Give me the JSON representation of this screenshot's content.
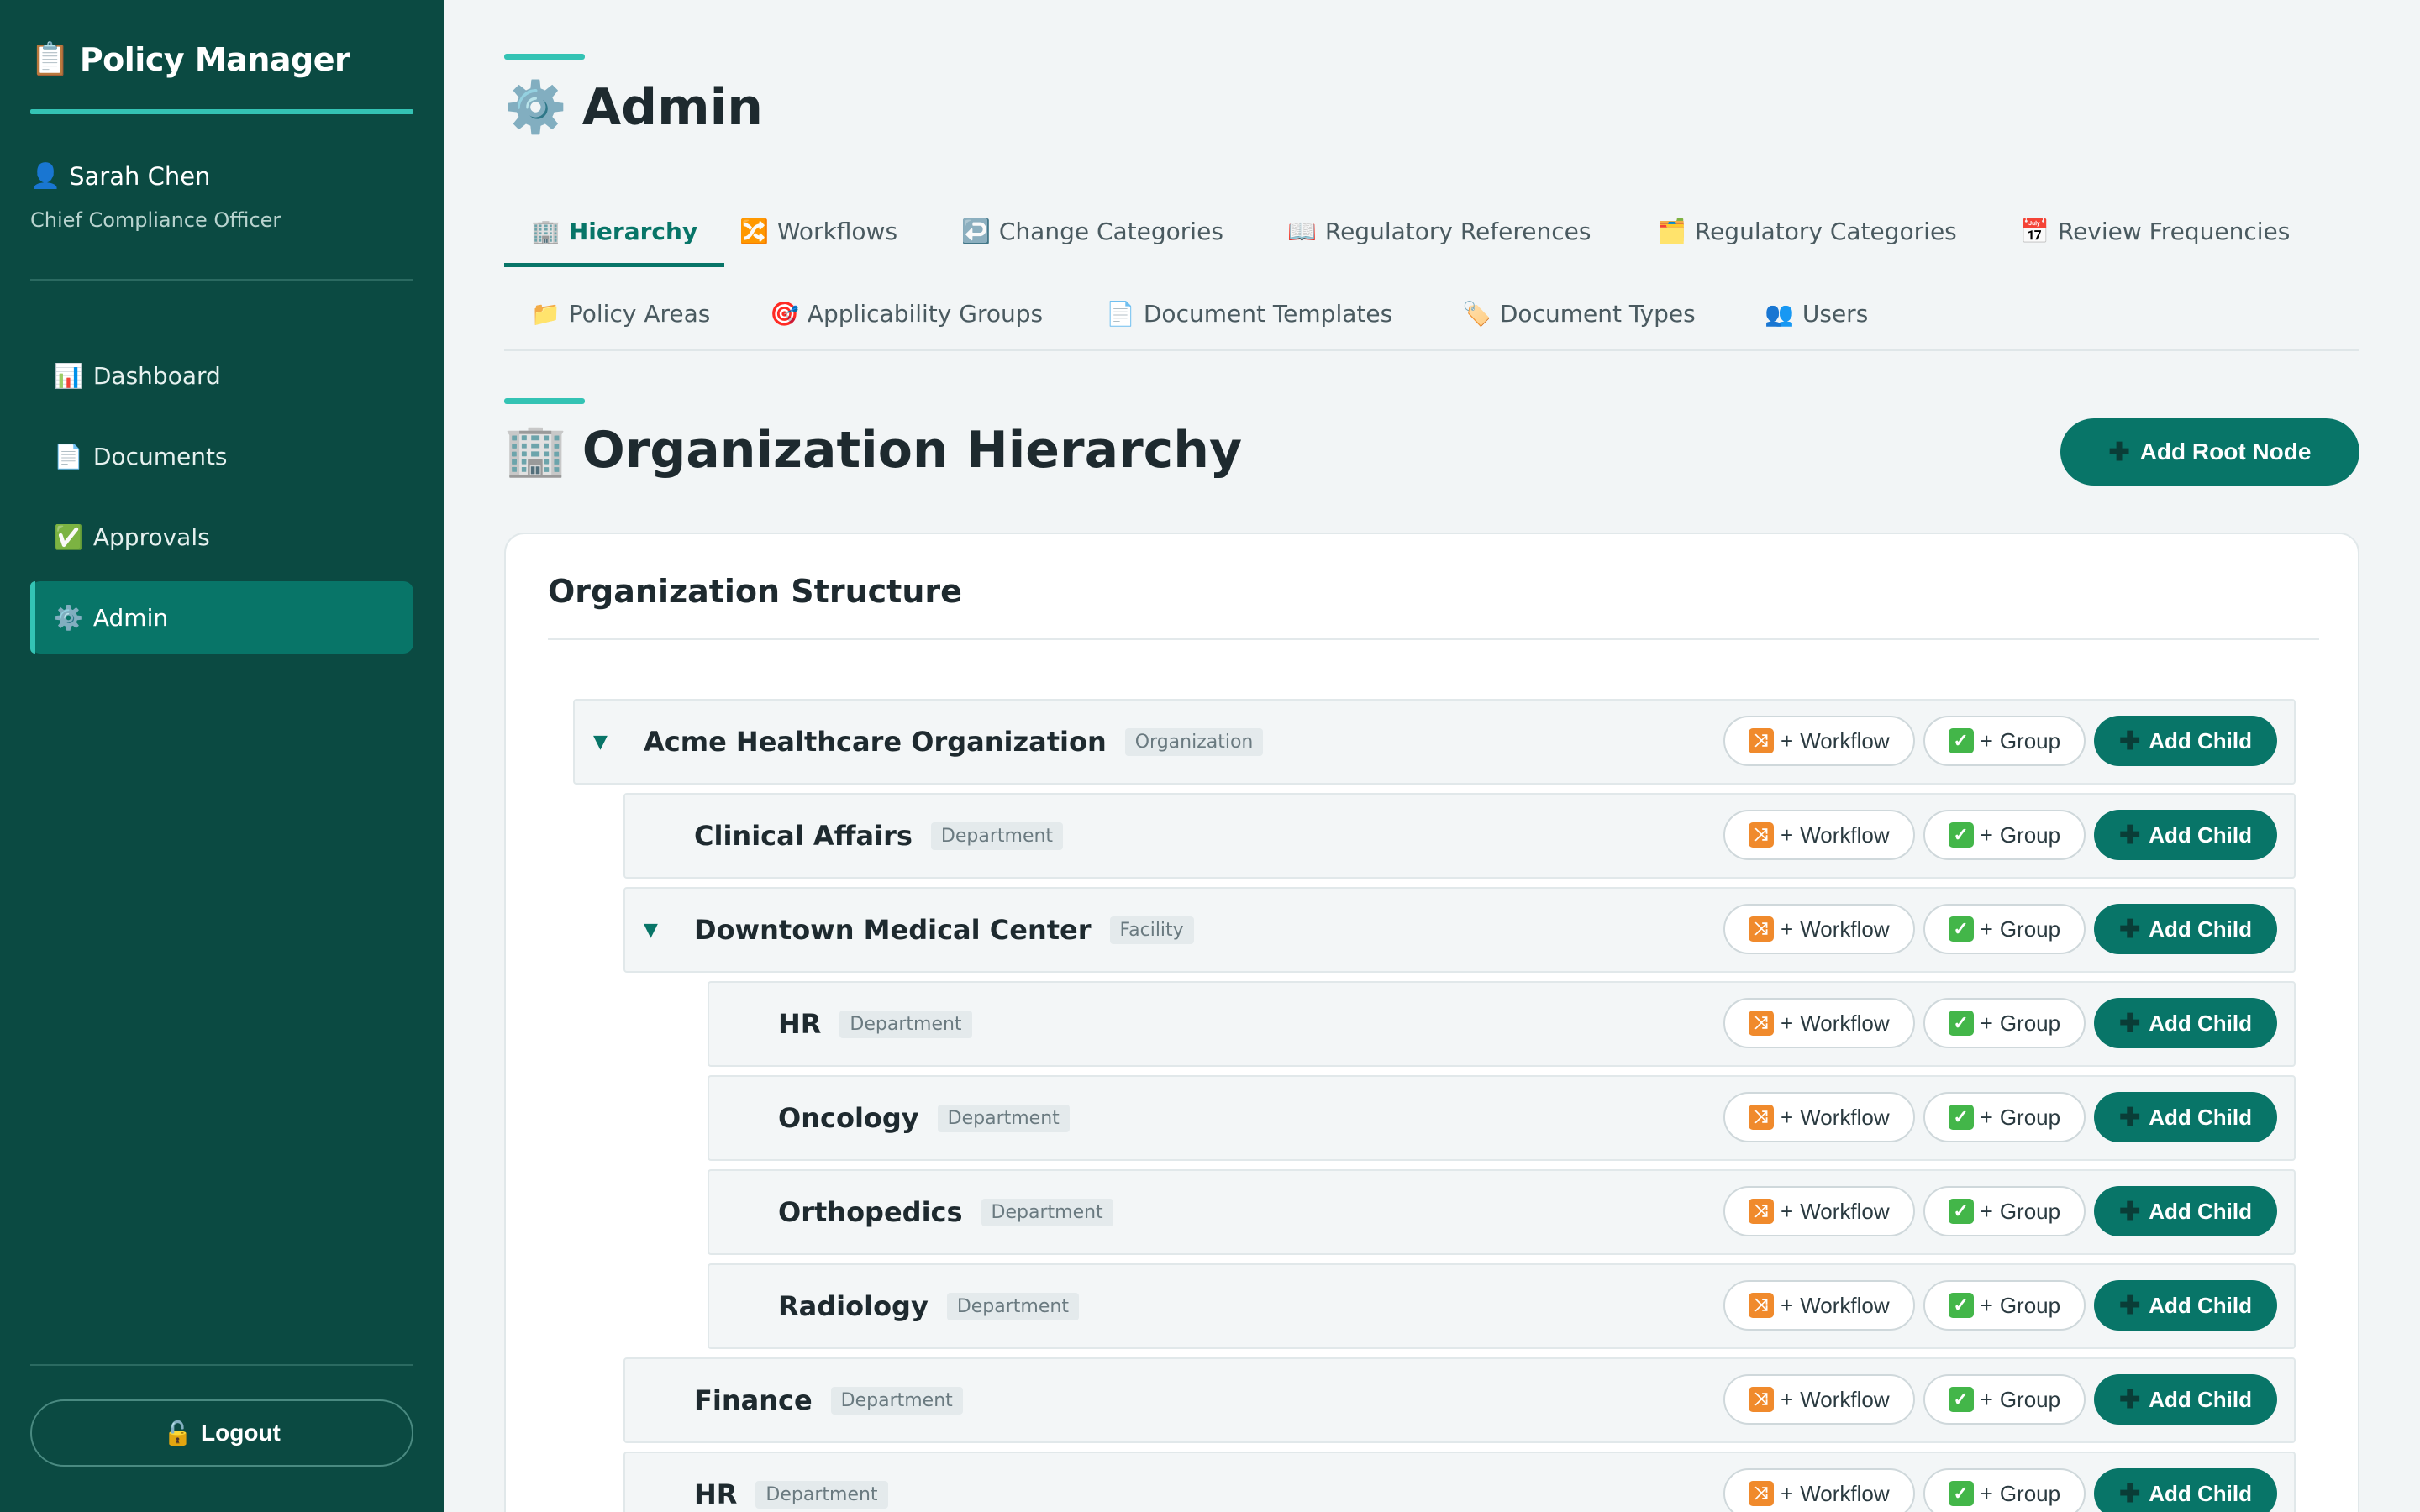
{
  "app": {
    "title": "Policy Manager",
    "title_icon": "clipboard-icon"
  },
  "user": {
    "name": "Sarah Chen",
    "role": "Chief Compliance Officer"
  },
  "nav": {
    "items": [
      {
        "label": "Dashboard",
        "icon": "📊"
      },
      {
        "label": "Documents",
        "icon": "📄"
      },
      {
        "label": "Approvals",
        "icon": "✅"
      },
      {
        "label": "Admin",
        "icon": "⚙️",
        "active": true
      }
    ],
    "logout_label": "Logout"
  },
  "page": {
    "title": "Admin",
    "section_title": "Organization Hierarchy",
    "add_root_label": "Add Root Node"
  },
  "tabs": [
    {
      "label": "Hierarchy",
      "icon": "🏢",
      "active": true
    },
    {
      "label": "Workflows",
      "icon": "🔀"
    },
    {
      "label": "Change Categories",
      "icon": "↩️"
    },
    {
      "label": "Regulatory References",
      "icon": "📖"
    },
    {
      "label": "Regulatory Categories",
      "icon": "🗂️"
    },
    {
      "label": "Review Frequencies",
      "icon": "📅"
    },
    {
      "label": "Policy Areas",
      "icon": "📁"
    },
    {
      "label": "Applicability Groups",
      "icon": "🎯"
    },
    {
      "label": "Document Templates",
      "icon": "📄"
    },
    {
      "label": "Document Types",
      "icon": "🏷️"
    },
    {
      "label": "Users",
      "icon": "👥"
    }
  ],
  "card": {
    "title": "Organization Structure"
  },
  "actions": {
    "workflow_label": "Workflow",
    "group_label": "Group",
    "add_child_label": "Add Child",
    "plus_text": "+"
  },
  "tree": [
    {
      "name": "Acme Healthcare Organization",
      "type": "Organization",
      "depth": 0,
      "expanded": true
    },
    {
      "name": "Clinical Affairs",
      "type": "Department",
      "depth": 1
    },
    {
      "name": "Downtown Medical Center",
      "type": "Facility",
      "depth": 1,
      "expanded": true
    },
    {
      "name": "HR",
      "type": "Department",
      "depth": 2
    },
    {
      "name": "Oncology",
      "type": "Department",
      "depth": 2
    },
    {
      "name": "Orthopedics",
      "type": "Department",
      "depth": 2
    },
    {
      "name": "Radiology",
      "type": "Department",
      "depth": 2
    },
    {
      "name": "Finance",
      "type": "Department",
      "depth": 1
    },
    {
      "name": "HR",
      "type": "Department",
      "depth": 1
    }
  ],
  "colors": {
    "sidebar": "#0b4a42",
    "accent": "#34c3b4",
    "primary": "#087568"
  }
}
